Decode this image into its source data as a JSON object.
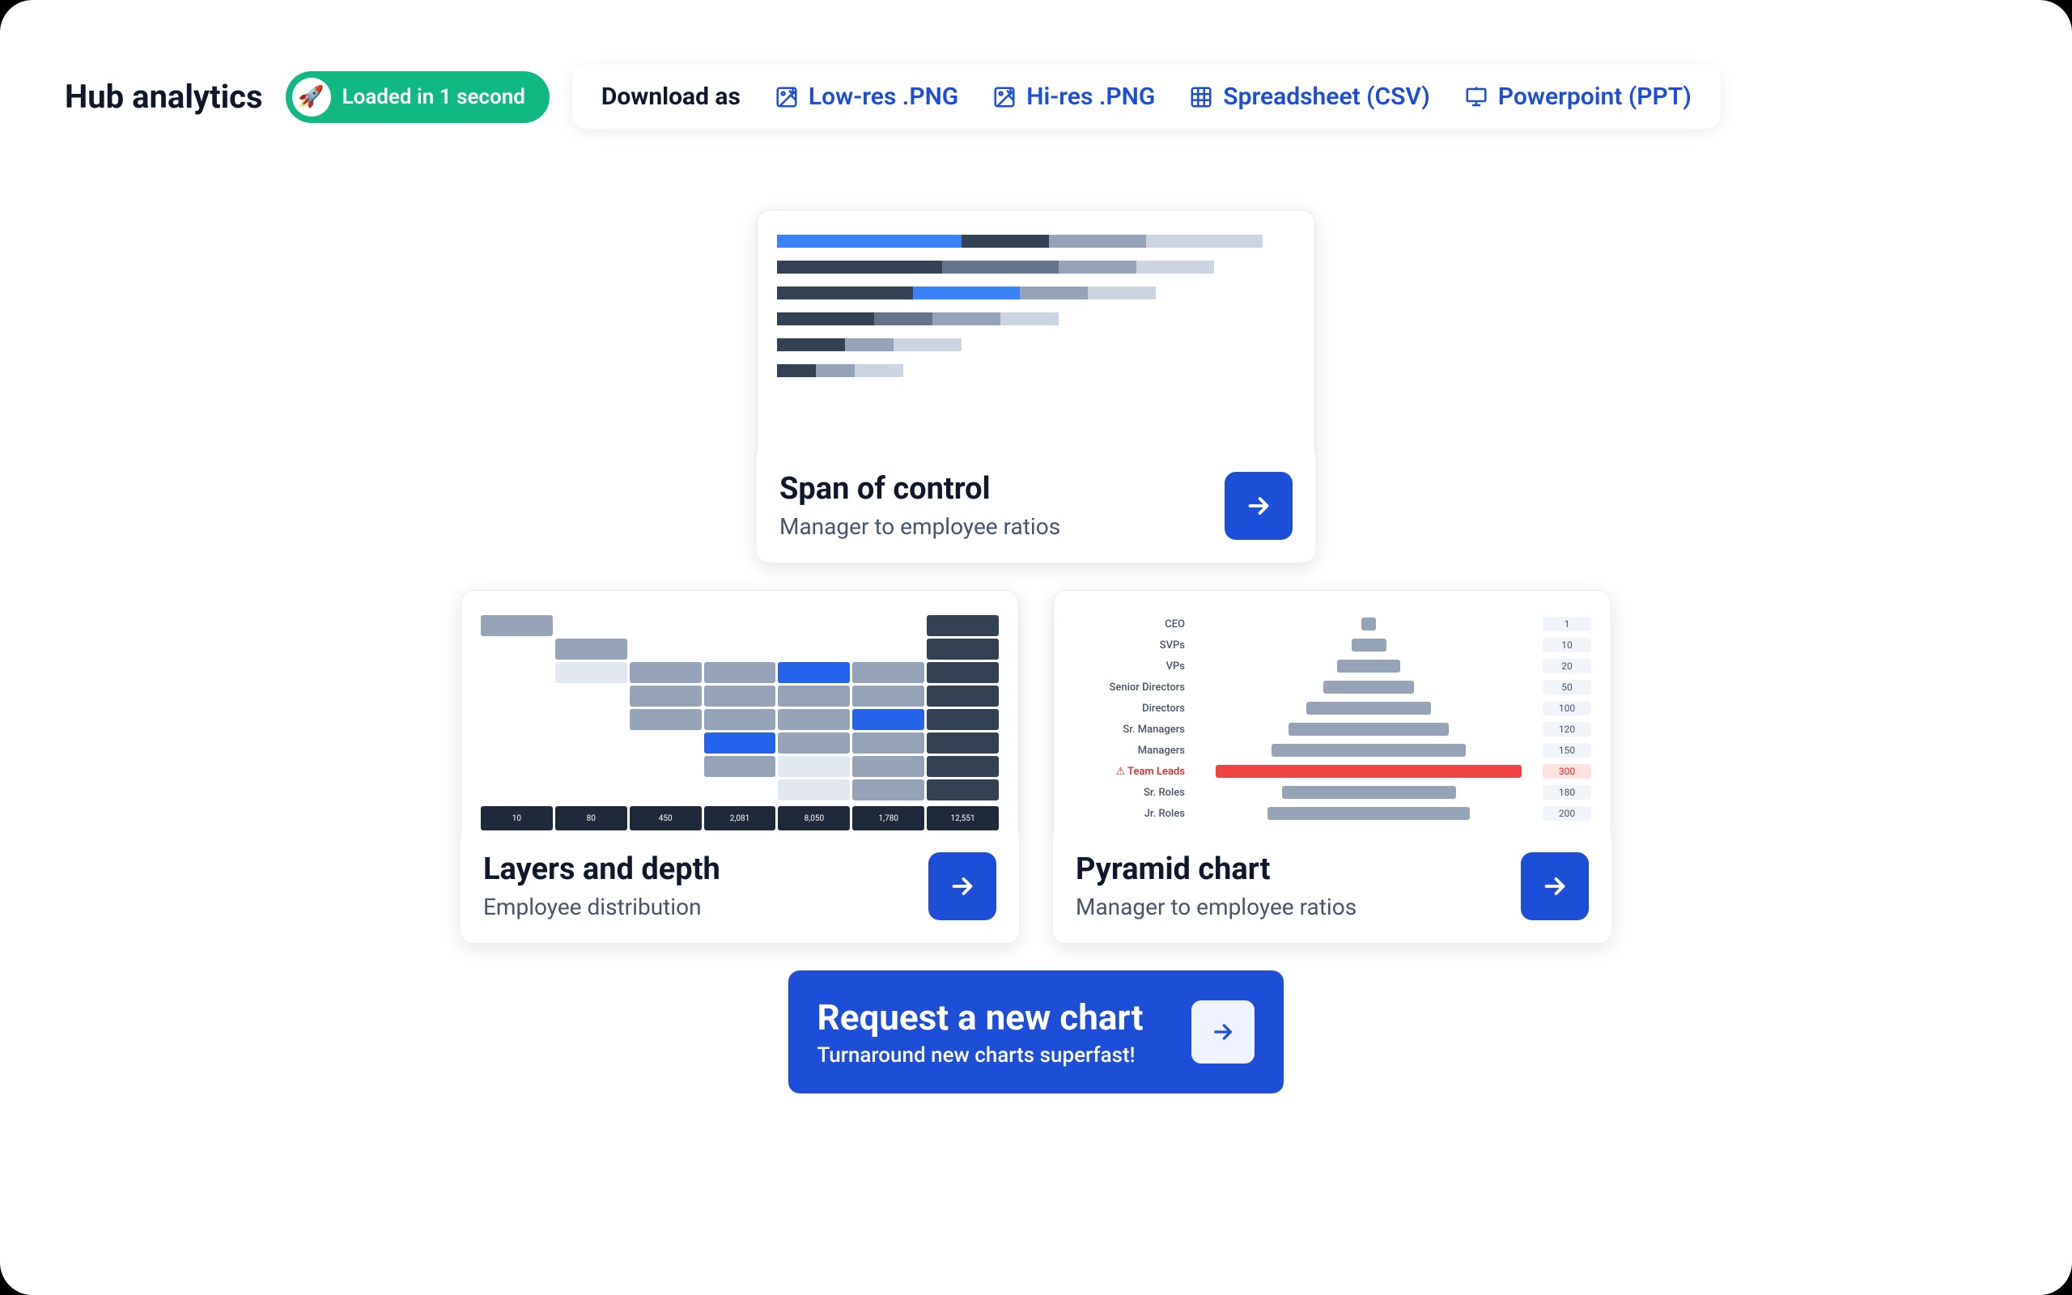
{
  "header": {
    "title": "Hub analytics",
    "loaded_label": "Loaded in 1 second"
  },
  "download": {
    "label": "Download as",
    "options": [
      {
        "id": "lowres",
        "label": "Low-res .PNG",
        "icon": "image-down"
      },
      {
        "id": "hires",
        "label": "Hi-res .PNG",
        "icon": "image-down"
      },
      {
        "id": "csv",
        "label": "Spreadsheet (CSV)",
        "icon": "table"
      },
      {
        "id": "ppt",
        "label": "Powerpoint (PPT)",
        "icon": "presentation"
      }
    ]
  },
  "cards": {
    "span": {
      "title": "Span of control",
      "subtitle": "Manager to employee ratios"
    },
    "layers": {
      "title": "Layers and depth",
      "subtitle": "Employee distribution"
    },
    "pyramid": {
      "title": "Pyramid chart",
      "subtitle": "Manager to employee ratios"
    }
  },
  "request": {
    "title": "Request a new chart",
    "subtitle": "Turnaround new charts superfast!"
  },
  "chart_data": {
    "span_of_control": {
      "type": "bar",
      "note": "horizontal stacked bars, widths as % of track",
      "rows": [
        {
          "segments": [
            {
              "w": 38,
              "c": "#3b82f6"
            },
            {
              "w": 18,
              "c": "#334155"
            },
            {
              "w": 20,
              "c": "#94a3b8"
            },
            {
              "w": 24,
              "c": "#cbd5e1"
            }
          ]
        },
        {
          "segments": [
            {
              "w": 34,
              "c": "#334155"
            },
            {
              "w": 24,
              "c": "#64748b"
            },
            {
              "w": 16,
              "c": "#94a3b8"
            },
            {
              "w": 16,
              "c": "#cbd5e1"
            }
          ]
        },
        {
          "segments": [
            {
              "w": 28,
              "c": "#334155"
            },
            {
              "w": 22,
              "c": "#3b82f6"
            },
            {
              "w": 14,
              "c": "#94a3b8"
            },
            {
              "w": 14,
              "c": "#cbd5e1"
            }
          ]
        },
        {
          "segments": [
            {
              "w": 20,
              "c": "#334155"
            },
            {
              "w": 12,
              "c": "#64748b"
            },
            {
              "w": 14,
              "c": "#94a3b8"
            },
            {
              "w": 12,
              "c": "#cbd5e1"
            }
          ]
        },
        {
          "segments": [
            {
              "w": 14,
              "c": "#334155"
            },
            {
              "w": 10,
              "c": "#94a3b8"
            },
            {
              "w": 14,
              "c": "#cbd5e1"
            }
          ]
        },
        {
          "segments": [
            {
              "w": 8,
              "c": "#334155"
            },
            {
              "w": 8,
              "c": "#94a3b8"
            },
            {
              "w": 10,
              "c": "#cbd5e1"
            }
          ]
        }
      ]
    },
    "layers": {
      "type": "table",
      "totals": [
        "10",
        "80",
        "450",
        "2,081",
        "8,050",
        "1,780",
        "12,551"
      ]
    },
    "pyramid": {
      "type": "bar",
      "rows": [
        {
          "label": "CEO",
          "value": 1,
          "w": 4
        },
        {
          "label": "SVPs",
          "value": 10,
          "w": 10
        },
        {
          "label": "VPs",
          "value": 20,
          "w": 18
        },
        {
          "label": "Senior Directors",
          "value": 50,
          "w": 26
        },
        {
          "label": "Directors",
          "value": 100,
          "w": 36
        },
        {
          "label": "Sr. Managers",
          "value": 120,
          "w": 46
        },
        {
          "label": "Managers",
          "value": 150,
          "w": 56
        },
        {
          "label": "⚠ Team Leads",
          "value": 300,
          "w": 88,
          "highlight": true
        },
        {
          "label": "Sr. Roles",
          "value": 180,
          "w": 50
        },
        {
          "label": "Jr. Roles",
          "value": 200,
          "w": 58
        }
      ]
    }
  }
}
